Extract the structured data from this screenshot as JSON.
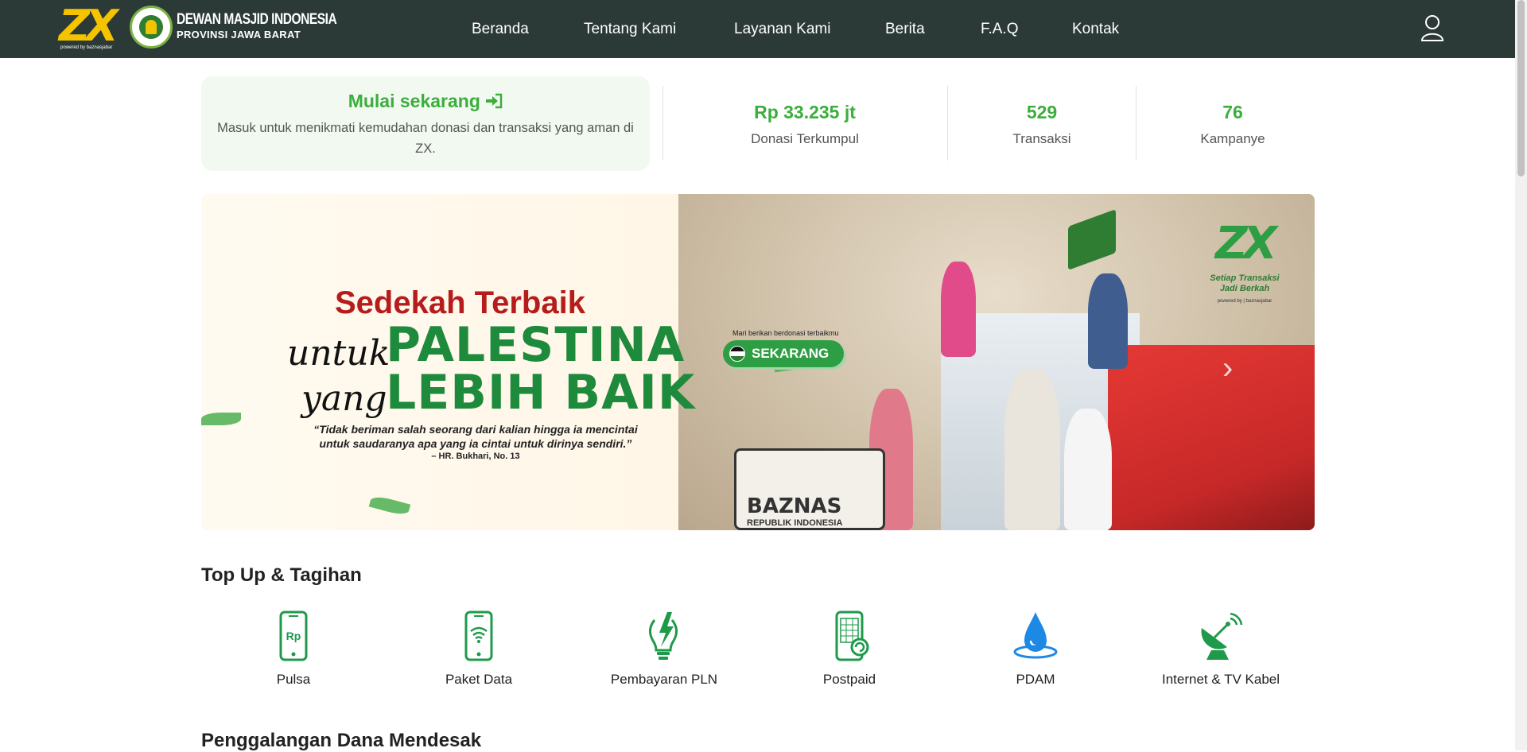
{
  "nav": {
    "brand_powered": "powered by baznasjabar",
    "org_title": "DEWAN MASJID INDONESIA",
    "org_sub": "PROVINSI JAWA BARAT",
    "links": [
      {
        "label": "Beranda"
      },
      {
        "label": "Tentang Kami"
      },
      {
        "label": "Layanan Kami"
      },
      {
        "label": "Berita"
      },
      {
        "label": "F.A.Q"
      },
      {
        "label": "Kontak"
      }
    ],
    "user_icon": "user-icon"
  },
  "cta": {
    "title": "Mulai sekarang",
    "icon": "sign-in-icon",
    "description": "Masuk untuk menikmati kemudahan donasi dan transaksi yang aman di ZX."
  },
  "stats": [
    {
      "value": "Rp 33.235 jt",
      "label": "Donasi Terkumpul"
    },
    {
      "value": "529",
      "label": "Transaksi"
    },
    {
      "value": "76",
      "label": "Kampanye"
    }
  ],
  "banner": {
    "title": "Sedekah Terbaik",
    "script1": "untuk",
    "line1": "PALESTINA",
    "script2": "yang",
    "line2": "LEBIH BAIK",
    "quote": "“Tidak beriman salah seorang dari kalian hingga ia mencintai untuk saudaranya apa yang ia cintai untuk dirinya sendiri.”",
    "source": "– HR. Bukhari, No. 13",
    "cta_small": "Mari berikan berdonasi terbaikmu",
    "cta_button": "SEKARANG",
    "brand": "ZX",
    "tagline1": "Setiap Transaksi",
    "tagline2": "Jadi Berkah",
    "brand_powered": "powered by | baznasjabar",
    "bag_text": "BAZNAS",
    "bag_sub": "REPUBLIK INDONESIA"
  },
  "topup": {
    "title": "Top Up & Tagihan",
    "services": [
      {
        "label": "Pulsa",
        "icon": "phone-rp-icon"
      },
      {
        "label": "Paket Data",
        "icon": "phone-wifi-icon"
      },
      {
        "label": "Pembayaran PLN",
        "icon": "lightbulb-bolt-icon"
      },
      {
        "label": "Postpaid",
        "icon": "phone-calculator-icon"
      },
      {
        "label": "PDAM",
        "icon": "water-drop-icon"
      },
      {
        "label": "Internet & TV Kabel",
        "icon": "satellite-dish-icon"
      }
    ]
  },
  "fundraising": {
    "title": "Penggalangan Dana Mendesak"
  },
  "colors": {
    "navbar": "#2b3a36",
    "accent_green": "#3cae3c",
    "brand_yellow": "#f5c400",
    "icon_green": "#1e9a4a",
    "pdam_blue": "#1e88e5"
  }
}
